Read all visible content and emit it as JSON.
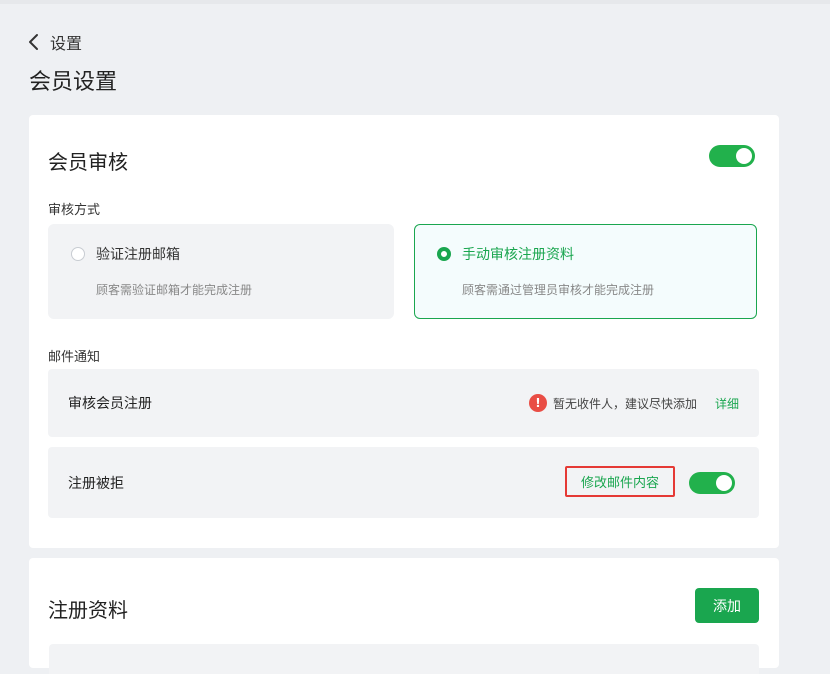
{
  "header": {
    "back_label": "设置",
    "page_title": "会员设置"
  },
  "member_review": {
    "title": "会员审核",
    "toggle_on": true,
    "method_label": "审核方式",
    "options": [
      {
        "title": "验证注册邮箱",
        "desc": "顾客需验证邮箱才能完成注册",
        "selected": false
      },
      {
        "title": "手动审核注册资料",
        "desc": "顾客需通过管理员审核才能完成注册",
        "selected": true
      }
    ],
    "email_label": "邮件通知",
    "notify_rows": [
      {
        "label": "审核会员注册",
        "warning": "暂无收件人，建议尽快添加",
        "detail": "详细"
      },
      {
        "label": "注册被拒",
        "edit_link": "修改邮件内容",
        "toggle_on": true
      }
    ]
  },
  "registration": {
    "title": "注册资料",
    "add_label": "添加"
  },
  "colors": {
    "accent": "#1aa64f",
    "toggle": "#22b14c",
    "warning": "#e94d45",
    "highlight_border": "#e53935"
  }
}
